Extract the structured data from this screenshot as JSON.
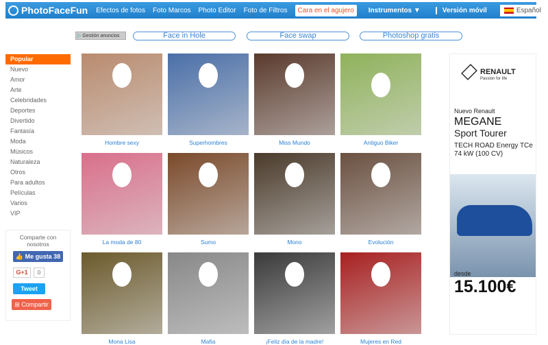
{
  "header": {
    "logo": "PhotoFaceFun",
    "nav": [
      "Efectos de fotos",
      "Foto Marcos",
      "Photo Editor",
      "Foto de Filtros",
      "Cara en el agujero",
      "Instrumentos ▼"
    ],
    "mobile": "Versión móvil",
    "language": "Español"
  },
  "subnav": {
    "ad_manage": "Gestión anuncios",
    "pills": [
      "Face in Hole",
      "Face swap",
      "Photoshop gratis"
    ]
  },
  "sidebar": {
    "items": [
      "Popular",
      "Nuevo",
      "Amor",
      "Arte",
      "Celebridades",
      "Deportes",
      "Divertido",
      "Fantasía",
      "Moda",
      "Músicos",
      "Naturaleza",
      "Otros",
      "Para adultos",
      "Películas",
      "Varios",
      "VIP"
    ]
  },
  "share": {
    "title": "Comparte con nosotros",
    "like": "Me gusta 38",
    "gplus": "G+1",
    "gplus_count": "0",
    "tweet": "Tweet",
    "share": "Compartir"
  },
  "gallery": [
    {
      "label": "Hombre sexy",
      "color": "#b98b6e"
    },
    {
      "label": "Superhombres",
      "color": "#4a6fa8"
    },
    {
      "label": "Miss Mundo",
      "color": "#5a3a2c"
    },
    {
      "label": "Antiguo Biker",
      "color": "#8fb25a"
    },
    {
      "label": "La moda de 80",
      "color": "#d96f8a"
    },
    {
      "label": "Sumo",
      "color": "#7a4a2a"
    },
    {
      "label": "Mono",
      "color": "#4a3a2a"
    },
    {
      "label": "Evolución",
      "color": "#6a5040"
    },
    {
      "label": "Mona Lisa",
      "color": "#6b5a2c"
    },
    {
      "label": "Mafia",
      "color": "#888888"
    },
    {
      "label": "¡Feliz día de la madre!",
      "color": "#3a3a3a"
    },
    {
      "label": "Mujeres en Red",
      "color": "#a82020"
    }
  ],
  "ad": {
    "brand": "RENAULT",
    "tagline": "Passion for life",
    "line1": "Nuevo Renault",
    "line2": "MEGANE",
    "line3": "Sport Tourer",
    "line4": "TECH ROAD Energy TCe 74 kW (100 CV)",
    "from": "desde",
    "price": "15.100€"
  }
}
